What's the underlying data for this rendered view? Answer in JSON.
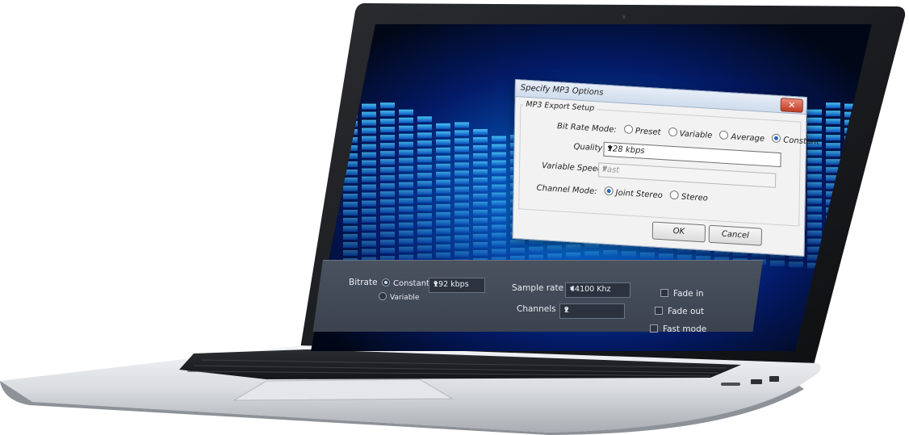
{
  "dialog": {
    "title": "Specify MP3 Options",
    "close_label": "✕",
    "group_title": "MP3 Export Setup",
    "bit_rate_mode_label": "Bit Rate Mode:",
    "bit_rate_modes": [
      "Preset",
      "Variable",
      "Average",
      "Constant"
    ],
    "bit_rate_mode_selected": "Constant",
    "quality_label": "Quality",
    "quality_value": "128 kbps",
    "variable_speed_label": "Variable Speed:",
    "variable_speed_value": "Fast",
    "channel_mode_label": "Channel Mode:",
    "channel_modes": [
      "Joint Stereo",
      "Stereo"
    ],
    "channel_mode_selected": "Joint Stereo",
    "ok_label": "OK",
    "cancel_label": "Cancel"
  },
  "panel": {
    "bitrate_label": "Bitrate",
    "bitrate_constant": "Constant",
    "bitrate_variable": "Variable",
    "bitrate_value": "192 kbps",
    "sample_rate_label": "Sample rate",
    "sample_rate_value": "44100 Khz",
    "channels_label": "Channels",
    "channels_value": "2",
    "fade_in_label": "Fade in",
    "fade_out_label": "Fade out",
    "fast_mode_label": "Fast mode"
  },
  "icons": {
    "dropdown": "chevron-down-icon",
    "close": "close-icon"
  },
  "colors": {
    "screen_glow": "#0a8de0",
    "screen_dark": "#010716",
    "panel_bg": "#3c434f",
    "dialog_bg": "#f2f2f2",
    "close_red": "#c23b22"
  }
}
